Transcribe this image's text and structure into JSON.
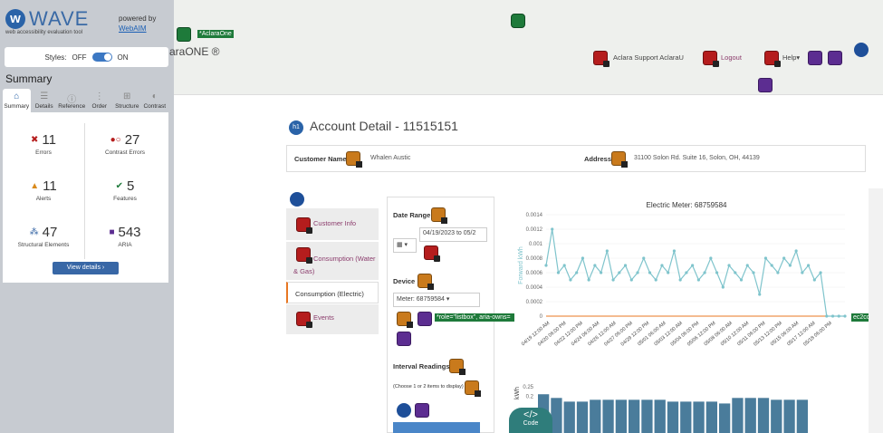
{
  "wave": {
    "logo_letter": "w",
    "logo_text": "WAVE",
    "subtitle": "web accessibility evaluation tool",
    "powered_by": "powered by",
    "webaim": "WebAIM",
    "styles_label": "Styles:",
    "off": "OFF",
    "on": "ON",
    "summary_title": "Summary",
    "tabs": [
      {
        "label": "Summary",
        "icon": "⌂"
      },
      {
        "label": "Details",
        "icon": "☰"
      },
      {
        "label": "Reference",
        "icon": "ⓘ"
      },
      {
        "label": "Order",
        "icon": "⋮"
      },
      {
        "label": "Structure",
        "icon": "⊞"
      },
      {
        "label": "Contrast",
        "icon": "◐"
      }
    ],
    "stats": {
      "errors": {
        "num": "11",
        "label": "Errors"
      },
      "contrast": {
        "num": "27",
        "label": "Contrast Errors"
      },
      "alerts": {
        "num": "11",
        "label": "Alerts"
      },
      "features": {
        "num": "5",
        "label": "Features"
      },
      "structural": {
        "num": "47",
        "label": "Structural Elements"
      },
      "aria": {
        "num": "543",
        "label": "ARIA"
      }
    },
    "view_details": "View details ›"
  },
  "top": {
    "aclara_tag": "*AclaraOne",
    "brand": "araONE ®",
    "support": "Aclara Support AclaraU",
    "logout": "Logout",
    "help": "Help▾"
  },
  "page": {
    "h1_icon": "h1",
    "title": "Account Detail - 11515151",
    "customer_name_label": "Customer Name",
    "customer_name": "Whalen Austic",
    "address_label": "Address",
    "address": "31100 Solon Rd. Suite 16, Solon, OH, 44139",
    "nav": [
      "Customer Info",
      "Consumption (Water & Gas)",
      "Consumption (Electric)",
      "Events"
    ],
    "date_range_label": "Date Range",
    "date_value": "04/19/2023 to 05/2",
    "device_label": "Device",
    "meter_value": "Meter: 68759584",
    "role_tag": "*role=\"listbox\", aria-owns=",
    "code_tag": "ec2cc4a8",
    "interval_label": "Interval Readings",
    "interval_hint": "(Choose 1 or 2 items to display)",
    "code_label": "Code"
  },
  "chart_data": [
    {
      "type": "line",
      "title": "Electric Meter: 68759584",
      "ylabel": "Forward kWh",
      "ylim": [
        0,
        0.0014
      ],
      "yticks": [
        "0",
        "0.0002",
        "0.0004",
        "0.0006",
        "0.0008",
        "0.001",
        "0.0012",
        "0.0014"
      ],
      "xticks": [
        "04/19 12:00 AM",
        "04/20 06:00 PM",
        "04/22 12:00 PM",
        "04/24 06:00 AM",
        "04/26 12:00 AM",
        "04/27 06:00 PM",
        "04/29 12:00 PM",
        "05/01 06:00 AM",
        "05/03 12:00 AM",
        "05/04 06:00 PM",
        "05/06 12:00 PM",
        "05/08 06:00 AM",
        "05/10 12:00 AM",
        "05/11 06:00 PM",
        "05/13 12:00 PM",
        "05/15 06:00 AM",
        "05/17 12:00 AM",
        "05/18 06:00 PM"
      ],
      "values": [
        0.0007,
        0.0012,
        0.0006,
        0.0007,
        0.0005,
        0.0006,
        0.0008,
        0.0005,
        0.0007,
        0.0006,
        0.0009,
        0.0005,
        0.0006,
        0.0007,
        0.0005,
        0.0006,
        0.0008,
        0.0006,
        0.0005,
        0.0007,
        0.0006,
        0.0009,
        0.0005,
        0.0006,
        0.0007,
        0.0005,
        0.0006,
        0.0008,
        0.0006,
        0.0004,
        0.0007,
        0.0006,
        0.0005,
        0.0007,
        0.0006,
        0.0003,
        0.0008,
        0.0007,
        0.0006,
        0.0008,
        0.0007,
        0.0009,
        0.0006,
        0.0007,
        0.0005,
        0.0006,
        0.0,
        0.0,
        0.0,
        0.0
      ]
    },
    {
      "type": "bar",
      "ylabel": "kWh",
      "yticks": [
        "0.2",
        "0.25"
      ],
      "ylim": [
        0,
        0.27
      ],
      "values": [
        0.21,
        0.19,
        0.17,
        0.17,
        0.18,
        0.18,
        0.18,
        0.18,
        0.18,
        0.18,
        0.17,
        0.17,
        0.17,
        0.17,
        0.16,
        0.19,
        0.19,
        0.19,
        0.18,
        0.18,
        0.18
      ]
    }
  ]
}
